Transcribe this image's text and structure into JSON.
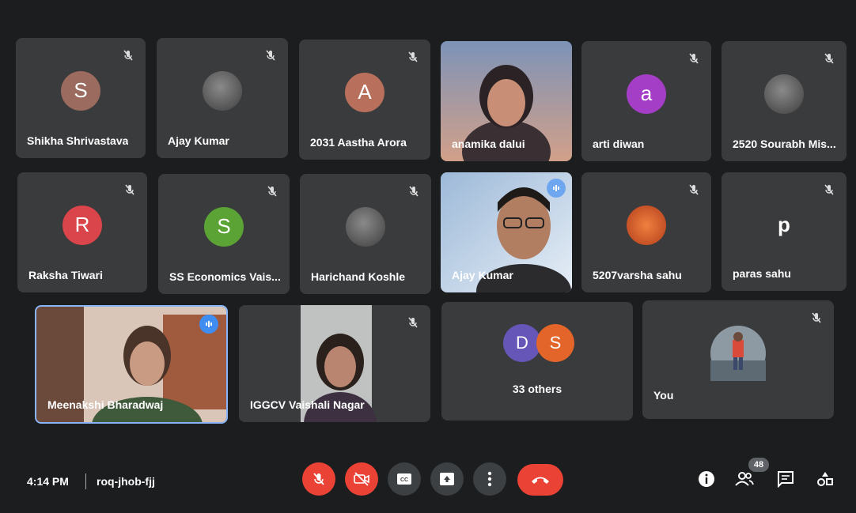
{
  "participants": [
    {
      "name": "Shikha Shrivastava",
      "initial": "S",
      "color": "#9a6b5e"
    },
    {
      "name": "Ajay Kumar"
    },
    {
      "name": "2031 Aastha Arora",
      "initial": "A",
      "color": "#b8705c"
    },
    {
      "name": "anamika dalui"
    },
    {
      "name": "arti diwan",
      "initial": "a",
      "color": "#a43ec6"
    },
    {
      "name": "2520 Sourabh Mis..."
    },
    {
      "name": "Raksha Tiwari",
      "initial": "R",
      "color": "#d9454a"
    },
    {
      "name": "SS Economics Vais...",
      "initial": "S",
      "color": "#5aa334"
    },
    {
      "name": "Harichand Koshle"
    },
    {
      "name": "Ajay Kumar"
    },
    {
      "name": "5207varsha sahu"
    },
    {
      "name": "paras sahu",
      "initial": "p",
      "color": "#3a3b3d"
    },
    {
      "name": "Meenakshi Bharadwaj"
    },
    {
      "name": "IGGCV Vaishali Nagar"
    }
  ],
  "others": {
    "label": "33 others",
    "initials": [
      "D",
      "S"
    ],
    "colors": [
      "#6656b8",
      "#e3652a"
    ]
  },
  "self": {
    "label": "You"
  },
  "bottom_bar": {
    "time": "4:14 PM",
    "meeting_code": "roq-jhob-fjj",
    "people_count": "48"
  },
  "icons": {
    "mic_off": "mic-off-icon",
    "cam_off": "camera-off-icon",
    "captions": "captions-icon",
    "present": "present-screen-icon",
    "more": "more-options-icon",
    "hangup": "hang-up-icon",
    "info": "info-icon",
    "people": "people-icon",
    "chat": "chat-icon",
    "activities": "activities-icon"
  },
  "colors": {
    "end_call": "#ea4335",
    "speaking": "#3f8df0"
  }
}
